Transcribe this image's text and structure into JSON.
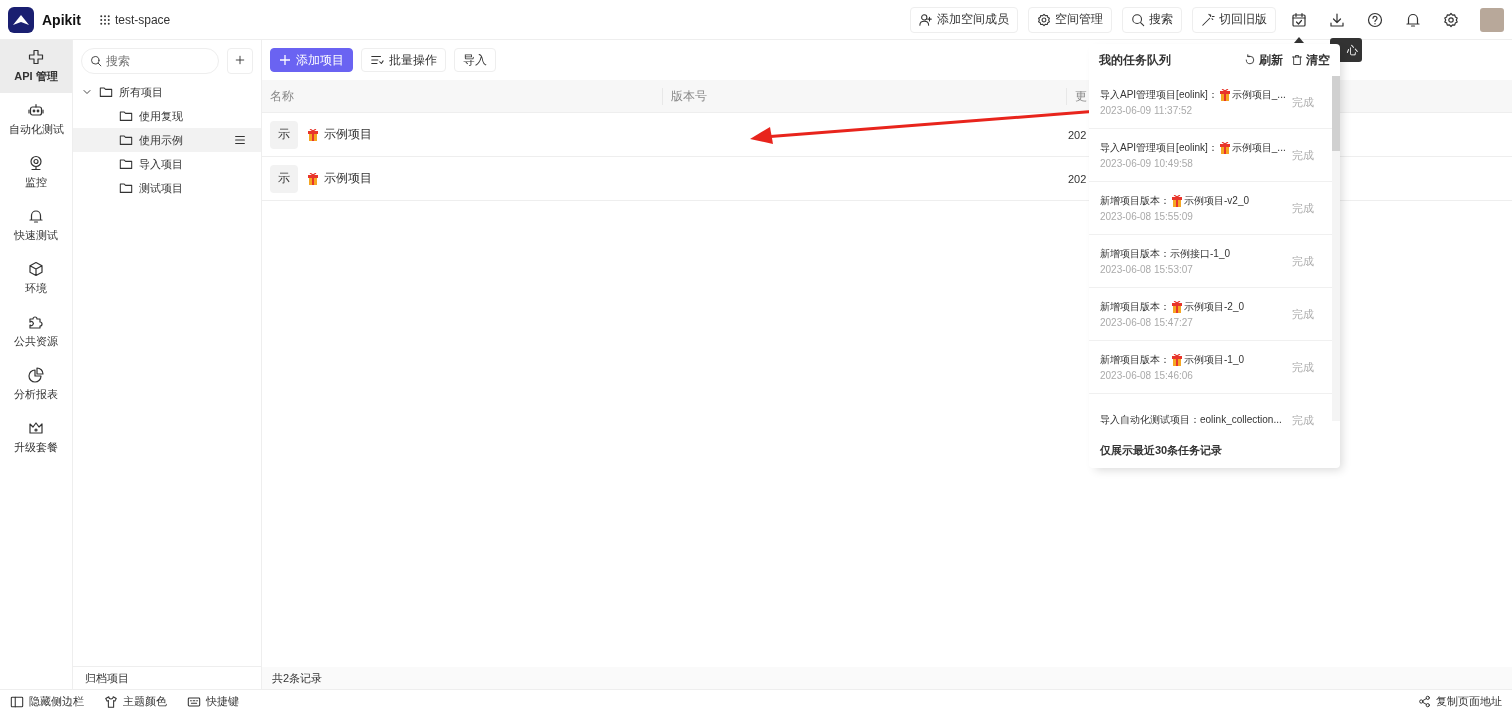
{
  "header": {
    "brand": "Apikit",
    "space": "test-space",
    "actions": [
      {
        "label": "添加空间成员"
      },
      {
        "label": "空间管理"
      },
      {
        "label": "搜索"
      },
      {
        "label": "切回旧版"
      }
    ]
  },
  "nav": [
    {
      "label": "API 管理",
      "selected": true
    },
    {
      "label": "自动化测试",
      "selected": false
    },
    {
      "label": "监控",
      "selected": false
    },
    {
      "label": "快速测试",
      "selected": false
    },
    {
      "label": "环境",
      "selected": false
    },
    {
      "label": "公共资源",
      "selected": false
    },
    {
      "label": "分析报表",
      "selected": false
    },
    {
      "label": "升级套餐",
      "selected": false
    }
  ],
  "tree": {
    "search_placeholder": "搜索",
    "nodes": [
      {
        "label": "所有项目",
        "expanded": true,
        "selected": false,
        "children": [
          {
            "label": "使用复现",
            "selected": false
          },
          {
            "label": "使用示例",
            "selected": true
          },
          {
            "label": "导入项目",
            "selected": false
          },
          {
            "label": "测试项目",
            "selected": false
          }
        ]
      }
    ],
    "footer": "归档项目"
  },
  "toolbar": {
    "buttons": [
      {
        "label": "添加项目",
        "kind": "primary"
      },
      {
        "label": "批量操作",
        "kind": "batch"
      },
      {
        "label": "导入",
        "kind": "plain"
      }
    ]
  },
  "table": {
    "columns": [
      "名称",
      "版本号",
      "更"
    ],
    "rows": [
      {
        "avatar": "示",
        "name": "示例项目",
        "column_3": "202"
      },
      {
        "avatar": "示",
        "name": "示例项目",
        "column_3": "202"
      }
    ],
    "footer": "共2条记录"
  },
  "tooltip": "心",
  "task_panel": {
    "title": "我的任务队列",
    "refresh": "刷新",
    "clear": "清空",
    "tasks": [
      {
        "prefix": "导入API管理项目[eolink]：",
        "project_icon": true,
        "name": "示例项目_...",
        "time": "2023-06-09 11:37:52",
        "status": "完成"
      },
      {
        "prefix": "导入API管理项目[eolink]：",
        "project_icon": true,
        "name": "示例项目_...",
        "time": "2023-06-09 10:49:58",
        "status": "完成"
      },
      {
        "prefix": "新增项目版本：",
        "project_icon": true,
        "name": "示例项目-v2_0",
        "time": "2023-06-08 15:55:09",
        "status": "完成"
      },
      {
        "prefix": "新增项目版本：",
        "project_icon": false,
        "name": "示例接口-1_0",
        "time": "2023-06-08 15:53:07",
        "status": "完成"
      },
      {
        "prefix": "新增项目版本：",
        "project_icon": true,
        "name": "示例项目-2_0",
        "time": "2023-06-08 15:47:27",
        "status": "完成"
      },
      {
        "prefix": "新增项目版本：",
        "project_icon": true,
        "name": "示例项目-1_0",
        "time": "2023-06-08 15:46:06",
        "status": "完成"
      },
      {
        "prefix": "导入自动化测试项目：",
        "project_icon": false,
        "name": "eolink_collection...",
        "status": "完成"
      }
    ],
    "footer": "仅展示最近30条任务记录"
  },
  "status_bar": {
    "left": [
      "隐藏侧边栏",
      "主题颜色",
      "快捷键"
    ],
    "right": "复制页面地址"
  }
}
